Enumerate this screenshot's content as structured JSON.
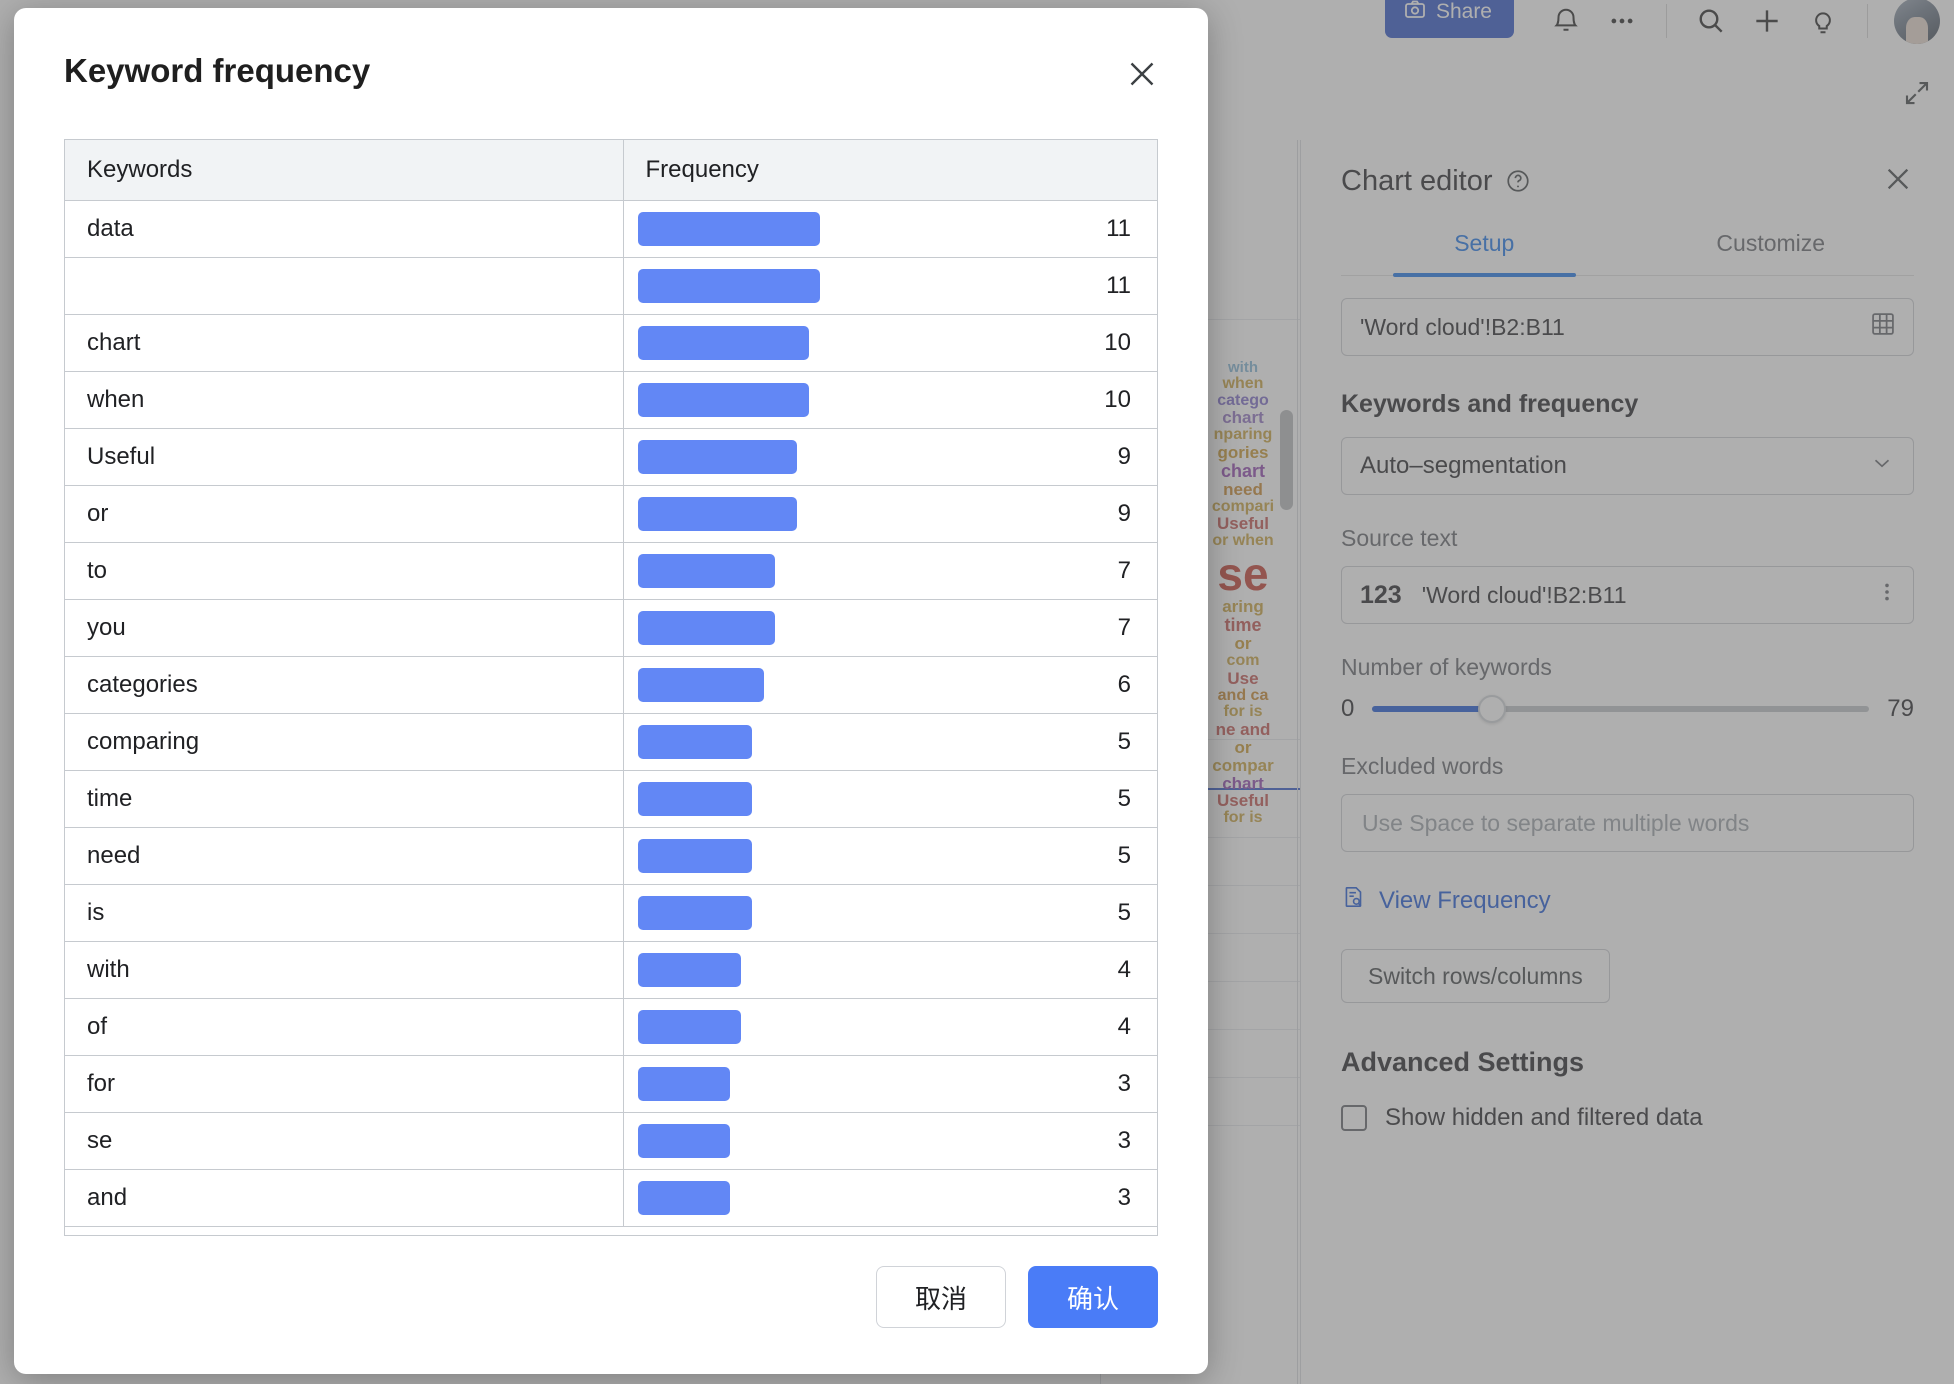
{
  "app": {
    "topbar": {
      "share_label": "Share",
      "icons": [
        "camera-icon",
        "bell-icon",
        "more-options-icon",
        "search-icon",
        "add-icon",
        "lightbulb-icon",
        "avatar"
      ]
    },
    "expand_icon": "expand-icon",
    "collapse_icon": "chevron-up-icon",
    "wordcloud_words": [
      {
        "text": "with",
        "color": "#7fb3d5",
        "size": 15
      },
      {
        "text": "when",
        "color": "#c8a13a",
        "size": 16
      },
      {
        "text": "catego",
        "color": "#7b68c8",
        "size": 16
      },
      {
        "text": "chart",
        "color": "#8e6fc0",
        "size": 17
      },
      {
        "text": "nparing",
        "color": "#c8a13a",
        "size": 16
      },
      {
        "text": "gories",
        "color": "#c8952a",
        "size": 17
      },
      {
        "text": "chart",
        "color": "#8e44ad",
        "size": 18
      },
      {
        "text": "need",
        "color": "#c8862a",
        "size": 17
      },
      {
        "text": "compari",
        "color": "#c8a13a",
        "size": 16
      },
      {
        "text": "Useful",
        "color": "#c0504d",
        "size": 17
      },
      {
        "text": "or when",
        "color": "#c8a13a",
        "size": 16
      },
      {
        "text": "se",
        "color": "#c0392b",
        "size": 46
      },
      {
        "text": "aring",
        "color": "#c8a13a",
        "size": 17
      },
      {
        "text": "time",
        "color": "#c0504d",
        "size": 18
      },
      {
        "text": "or",
        "color": "#c8952a",
        "size": 17
      },
      {
        "text": "com",
        "color": "#c8a13a",
        "size": 16
      },
      {
        "text": "Use",
        "color": "#c0504d",
        "size": 17
      },
      {
        "text": "and ca",
        "color": "#c8862a",
        "size": 16
      },
      {
        "text": "for is",
        "color": "#c8a13a",
        "size": 16
      },
      {
        "text": "ne and",
        "color": "#c0504d",
        "size": 17
      },
      {
        "text": "or",
        "color": "#c8952a",
        "size": 17
      },
      {
        "text": "compar",
        "color": "#c8a13a",
        "size": 17
      },
      {
        "text": "chart",
        "color": "#8e44ad",
        "size": 17
      },
      {
        "text": "Useful",
        "color": "#c0504d",
        "size": 17
      },
      {
        "text": "for is",
        "color": "#c8a13a",
        "size": 16
      }
    ]
  },
  "chart_editor": {
    "title": "Chart editor",
    "help_icon": "help-circle-icon",
    "close_icon": "close-icon",
    "tabs": [
      {
        "label": "Setup",
        "active": true
      },
      {
        "label": "Customize",
        "active": false
      }
    ],
    "range_value": "'Word cloud'!B2:B11",
    "range_icon": "grid-select-icon",
    "keywords_section_label": "Keywords and frequency",
    "segmentation_value": "Auto–segmentation",
    "segmentation_caret": "chevron-down-icon",
    "source_text_label": "Source text",
    "source_text_badge": "123",
    "source_text_value": "'Word cloud'!B2:B11",
    "source_text_menu_icon": "kebab-menu-icon",
    "num_keywords_label": "Number of keywords",
    "num_keywords_min": "0",
    "num_keywords_max": "79",
    "num_keywords_fill_percent": 24,
    "excluded_words_label": "Excluded words",
    "excluded_words_placeholder": "Use Space to separate multiple words",
    "excluded_words_value": "",
    "view_frequency_label": "View Frequency",
    "view_frequency_icon": "document-search-icon",
    "switch_rows_columns_label": "Switch rows/columns",
    "advanced_settings_label": "Advanced Settings",
    "show_hidden_label": "Show hidden and filtered data",
    "show_hidden_checked": false
  },
  "modal": {
    "title": "Keyword frequency",
    "close_icon": "close-icon",
    "cancel_label": "取消",
    "confirm_label": "确认",
    "accent_color": "#4a7cf7",
    "bar_color": "#6287f5"
  },
  "chart_data": {
    "type": "bar",
    "title": "Keyword frequency",
    "orientation": "horizontal",
    "headers": [
      "Keywords",
      "Frequency"
    ],
    "xlabel": "Frequency",
    "ylabel": "Keywords",
    "xlim": [
      0,
      11
    ],
    "grid": false,
    "legend": false,
    "categories": [
      "data",
      "",
      "chart",
      "when",
      "Useful",
      "or",
      "to",
      "you",
      "categories",
      "comparing",
      "time",
      "need",
      "is",
      "with",
      "of",
      "for",
      "se",
      "and"
    ],
    "values": [
      11,
      11,
      10,
      10,
      9,
      9,
      7,
      7,
      6,
      5,
      5,
      5,
      5,
      4,
      4,
      3,
      3,
      3
    ]
  }
}
